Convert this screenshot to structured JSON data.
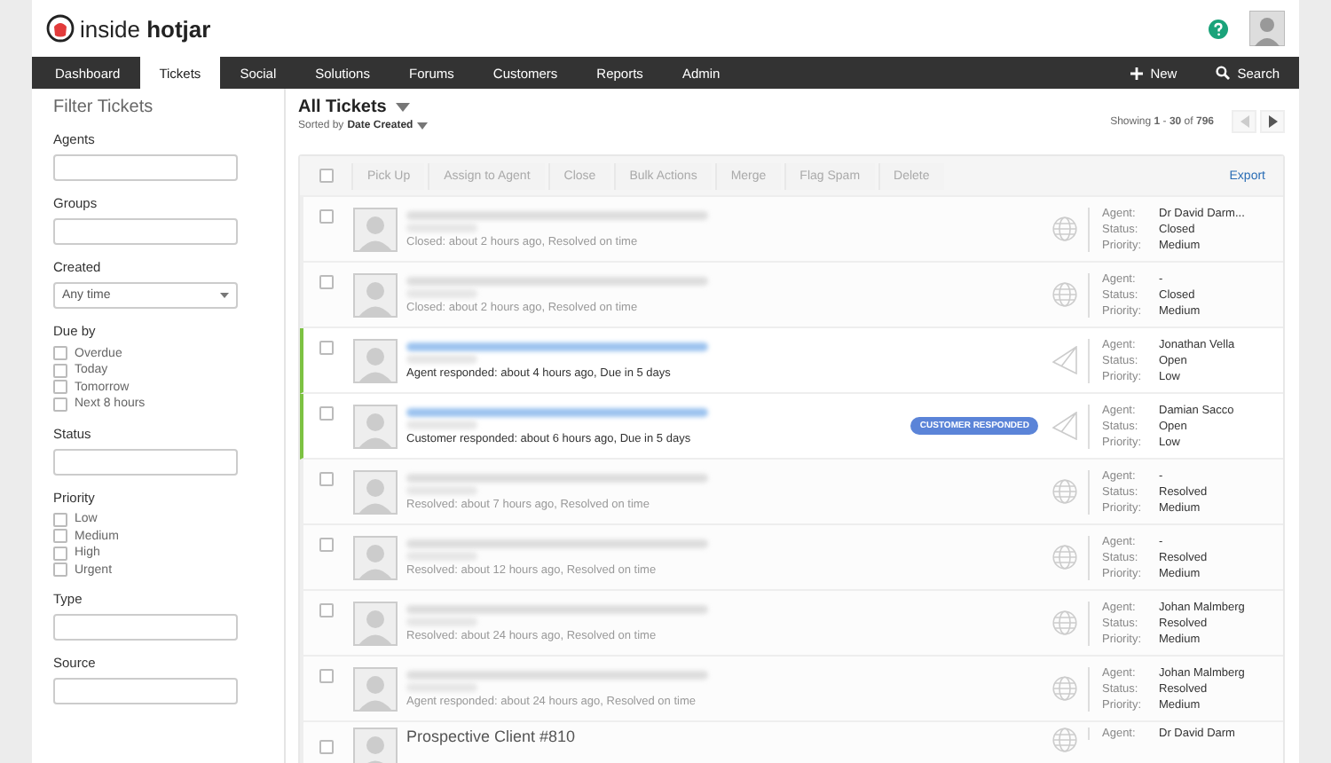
{
  "header": {
    "logo_text": "inside",
    "logo_bold": "hotjar"
  },
  "nav": {
    "tabs": [
      {
        "label": "Dashboard",
        "selected": false
      },
      {
        "label": "Tickets",
        "selected": true
      },
      {
        "label": "Social",
        "selected": false
      },
      {
        "label": "Solutions",
        "selected": false
      },
      {
        "label": "Forums",
        "selected": false
      },
      {
        "label": "Customers",
        "selected": false
      },
      {
        "label": "Reports",
        "selected": false
      },
      {
        "label": "Admin",
        "selected": false
      }
    ],
    "new_label": "New",
    "search_label": "Search"
  },
  "sidebar": {
    "title": "Filter Tickets",
    "filters": [
      {
        "kind": "text",
        "label": "Agents"
      },
      {
        "kind": "text",
        "label": "Groups"
      },
      {
        "kind": "select",
        "label": "Created",
        "value": "Any time"
      },
      {
        "kind": "checks",
        "label": "Due by",
        "options": [
          {
            "label": "Overdue",
            "checked": false
          },
          {
            "label": "Today",
            "checked": false
          },
          {
            "label": "Tomorrow",
            "checked": false
          },
          {
            "label": "Next 8 hours",
            "checked": false
          }
        ]
      },
      {
        "kind": "text",
        "label": "Status"
      },
      {
        "kind": "checks",
        "label": "Priority",
        "options": [
          {
            "label": "Low",
            "checked": false
          },
          {
            "label": "Medium",
            "checked": false
          },
          {
            "label": "High",
            "checked": false
          },
          {
            "label": "Urgent",
            "checked": false
          }
        ]
      },
      {
        "kind": "text",
        "label": "Type"
      },
      {
        "kind": "text",
        "label": "Source"
      }
    ]
  },
  "main": {
    "title": "All Tickets",
    "sorted_prefix": "Sorted by",
    "sorted_by": "Date Created",
    "showing": "Showing **1** - **30** of **796**",
    "toolbar": {
      "select_all_checked": false,
      "actions": [
        "Pick Up",
        "Assign to Agent",
        "Close",
        "Bulk Actions",
        "Merge",
        "Flag Spam",
        "Delete"
      ],
      "export": "Export"
    },
    "tickets": [
      {
        "checked": false,
        "kind": "web",
        "open": false,
        "activity": "Closed: about 2 hours ago, Resolved on time",
        "fields": [
          {
            "label": "Agent:",
            "value": "Dr David Darm..."
          },
          {
            "label": "Status:",
            "value": "Closed"
          },
          {
            "label": "Priority:",
            "value": "Medium"
          }
        ]
      },
      {
        "checked": false,
        "kind": "web",
        "open": false,
        "activity": "Closed: about 2 hours ago, Resolved on time",
        "fields": [
          {
            "label": "Agent:",
            "value": "-"
          },
          {
            "label": "Status:",
            "value": "Closed"
          },
          {
            "label": "Priority:",
            "value": "Medium"
          }
        ]
      },
      {
        "checked": false,
        "kind": "email",
        "open": true,
        "activity": "Agent responded: about 4 hours ago, Due in 5 days",
        "fields": [
          {
            "label": "Agent:",
            "value": "Jonathan Vella"
          },
          {
            "label": "Status:",
            "value": "Open"
          },
          {
            "label": "Priority:",
            "value": "Low"
          }
        ]
      },
      {
        "checked": false,
        "kind": "email",
        "open": true,
        "activity": "Customer responded: about 6 hours ago, Due in 5 days",
        "badge": "CUSTOMER RESPONDED",
        "fields": [
          {
            "label": "Agent:",
            "value": "Damian Sacco"
          },
          {
            "label": "Status:",
            "value": "Open"
          },
          {
            "label": "Priority:",
            "value": "Low"
          }
        ]
      },
      {
        "checked": false,
        "kind": "web",
        "open": false,
        "activity": "Resolved: about 7 hours ago, Resolved on time",
        "fields": [
          {
            "label": "Agent:",
            "value": "-"
          },
          {
            "label": "Status:",
            "value": "Resolved"
          },
          {
            "label": "Priority:",
            "value": "Medium"
          }
        ]
      },
      {
        "checked": false,
        "kind": "web",
        "open": false,
        "activity": "Resolved: about 12 hours ago, Resolved on time",
        "fields": [
          {
            "label": "Agent:",
            "value": "-"
          },
          {
            "label": "Status:",
            "value": "Resolved"
          },
          {
            "label": "Priority:",
            "value": "Medium"
          }
        ]
      },
      {
        "checked": false,
        "kind": "web",
        "open": false,
        "activity": "Resolved: about 24 hours ago, Resolved on time",
        "fields": [
          {
            "label": "Agent:",
            "value": "Johan Malmberg"
          },
          {
            "label": "Status:",
            "value": "Resolved"
          },
          {
            "label": "Priority:",
            "value": "Medium"
          }
        ]
      },
      {
        "checked": false,
        "kind": "web",
        "open": false,
        "activity": "Agent responded: about 24 hours ago, Resolved on time",
        "fields": [
          {
            "label": "Agent:",
            "value": "Johan Malmberg"
          },
          {
            "label": "Status:",
            "value": "Resolved"
          },
          {
            "label": "Priority:",
            "value": "Medium"
          }
        ]
      },
      {
        "checked": false,
        "kind": "web",
        "open": false,
        "subject": "Prospective Client #810",
        "fields": [
          {
            "label": "Agent:",
            "value": "Dr David Darm"
          }
        ]
      }
    ]
  }
}
